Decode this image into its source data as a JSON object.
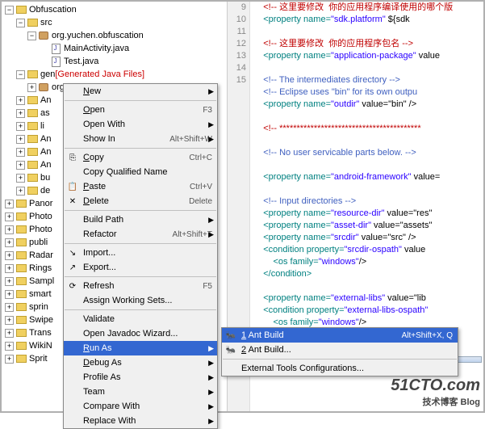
{
  "tree": {
    "root": "Obfuscation",
    "src": "src",
    "pkg1": "org.yuchen.obfuscation",
    "f1": "MainActivity.java",
    "f2": "Test.java",
    "gen": "gen",
    "genNote": "[Generated Java Files]",
    "pkg2": "org.yuchen.obfuscation",
    "partial": [
      "An",
      "as",
      "li",
      "An",
      "An",
      "An",
      "bu",
      "de",
      "Panor",
      "Photo",
      "Photo",
      "publi",
      "Radar",
      "Rings",
      "Sampl",
      "smart",
      "sprin",
      "Swipe",
      "Trans",
      "WikiN",
      "Sprit"
    ]
  },
  "gutter": [
    "9",
    "10",
    "11",
    "12",
    "13",
    "14",
    "15"
  ],
  "code": {
    "l1": {
      "c": "    <!-- 这里要修改  你的应用程序编译使用的哪个版"
    },
    "l2": {
      "p": "    <property name=",
      "n": "\"sdk.platform\"",
      "v": "${sdk"
    },
    "l3": "",
    "l4": {
      "c": "<!-- 这里要修改  你的应用程序包名 -->"
    },
    "l5": {
      "p": "    <property name=",
      "n": "\"application-package\"",
      "v": " value"
    },
    "l6": "",
    "l7": {
      "c": "<!-- The intermediates directory -->"
    },
    "l8": {
      "c": "<!-- Eclipse uses \"bin\" for its own outpu"
    },
    "l9": {
      "p": "    <property name=",
      "n": "\"outdir\"",
      "v": " value=\"bin\" />"
    },
    "l10": "",
    "l11": {
      "c": "<!-- *****************************************"
    },
    "l12": "",
    "l13": {
      "c": "<!-- No user servicable parts below. -->"
    },
    "l14": "",
    "l15": {
      "p": "    <property name=",
      "n": "\"android-framework\"",
      "v": " value="
    },
    "l16": "",
    "l17": {
      "c": "<!-- Input directories -->"
    },
    "l18": {
      "p": "    <property name=",
      "n": "\"resource-dir\"",
      "v": " value=\"res\""
    },
    "l19": {
      "p": "    <property name=",
      "n": "\"asset-dir\"",
      "v": " value=\"assets\""
    },
    "l20": {
      "p": "    <property name=",
      "n": "\"srcdir\"",
      "v": " value=\"src\" />"
    },
    "l21": {
      "p": "    <condition property=",
      "n": "\"srcdir-ospath\"",
      "v": " value"
    },
    "l22": {
      "p": "        <os family=",
      "n": "\"windows\"",
      "v": "/>"
    },
    "l23": {
      "t": "    </condition>"
    },
    "l24": "",
    "l25": {
      "p": "    <property name=",
      "n": "\"external-libs\"",
      "v": " value=\"lib"
    },
    "l26": {
      "p": "    <condition property=",
      "n": "\"external-libs-ospath\""
    },
    "l27": {
      "p": "        <os family=",
      "n": "\"windows\"",
      "v": "/>"
    }
  },
  "ctx": [
    {
      "label": "New",
      "arr": true,
      "u": "N"
    },
    {
      "sep": true
    },
    {
      "label": "Open",
      "key": "F3",
      "u": "O"
    },
    {
      "label": "Open With",
      "arr": true
    },
    {
      "label": "Show In",
      "key": "Alt+Shift+W",
      "arr": true
    },
    {
      "sep": true
    },
    {
      "label": "Copy",
      "key": "Ctrl+C",
      "ico": "⎘",
      "u": "C"
    },
    {
      "label": "Copy Qualified Name"
    },
    {
      "label": "Paste",
      "key": "Ctrl+V",
      "ico": "📋",
      "u": "P"
    },
    {
      "label": "Delete",
      "key": "Delete",
      "ico": "✕",
      "u": "D"
    },
    {
      "sep": true
    },
    {
      "label": "Build Path",
      "arr": true
    },
    {
      "label": "Refactor",
      "key": "Alt+Shift+T",
      "arr": true,
      "u": "T"
    },
    {
      "sep": true
    },
    {
      "label": "Import...",
      "ico": "↘"
    },
    {
      "label": "Export...",
      "ico": "↗"
    },
    {
      "sep": true
    },
    {
      "label": "Refresh",
      "key": "F5",
      "ico": "⟳"
    },
    {
      "label": "Assign Working Sets..."
    },
    {
      "sep": true
    },
    {
      "label": "Validate"
    },
    {
      "label": "Open Javadoc Wizard..."
    },
    {
      "label": "Run As",
      "arr": true,
      "hi": true,
      "u": "R"
    },
    {
      "label": "Debug As",
      "arr": true,
      "u": "D"
    },
    {
      "label": "Profile As",
      "arr": true
    },
    {
      "label": "Team",
      "arr": true
    },
    {
      "label": "Compare With",
      "arr": true
    },
    {
      "label": "Replace With",
      "arr": true
    }
  ],
  "sub": [
    {
      "label": "1 Ant Build",
      "key": "Alt+Shift+X, Q",
      "hi": true,
      "ico": "🐜",
      "u": "1"
    },
    {
      "label": "2 Ant Build...",
      "ico": "🐜",
      "u": "2"
    },
    {
      "sep": true
    },
    {
      "label": "External Tools Configurations..."
    }
  ],
  "wm": {
    "big": "51CTO.com",
    "sm": "技术博客  Blog"
  }
}
